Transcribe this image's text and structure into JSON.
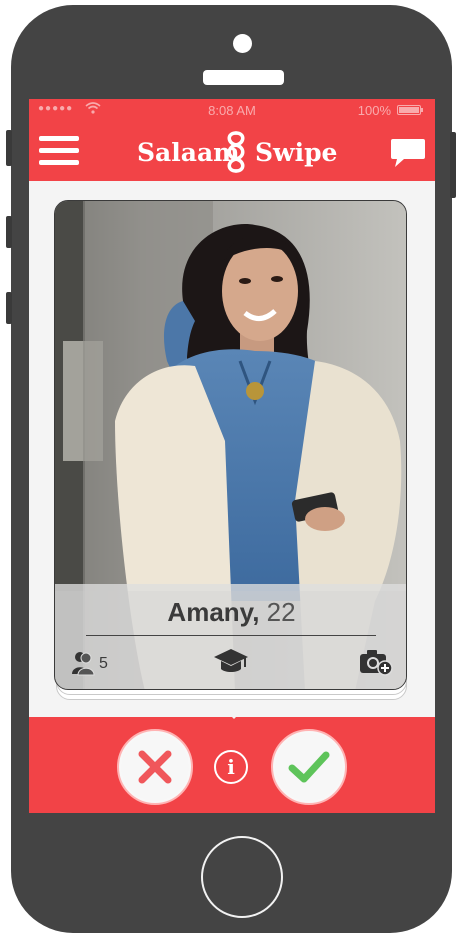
{
  "status_bar": {
    "signal": "●●●●●",
    "time": "8:08 AM",
    "battery": "100%",
    "battery_level": 1.0
  },
  "navbar": {
    "logo_left": "Salaam",
    "logo_right": "Swipe",
    "menu_icon": "hamburger-menu-icon",
    "chat_icon": "chat-bubble-icon"
  },
  "profile": {
    "name": "Amany,",
    "age": "22",
    "mutual_friends": "5",
    "education_icon": "graduation-cap-icon",
    "photos_icon": "add-photo-icon"
  },
  "actions": {
    "reject_icon": "x-icon",
    "info_label": "i",
    "accept_icon": "checkmark-icon"
  },
  "colors": {
    "brand": "#f24347",
    "phone_body": "#444444",
    "reject": "#f0575b",
    "accept": "#5ec45a"
  }
}
